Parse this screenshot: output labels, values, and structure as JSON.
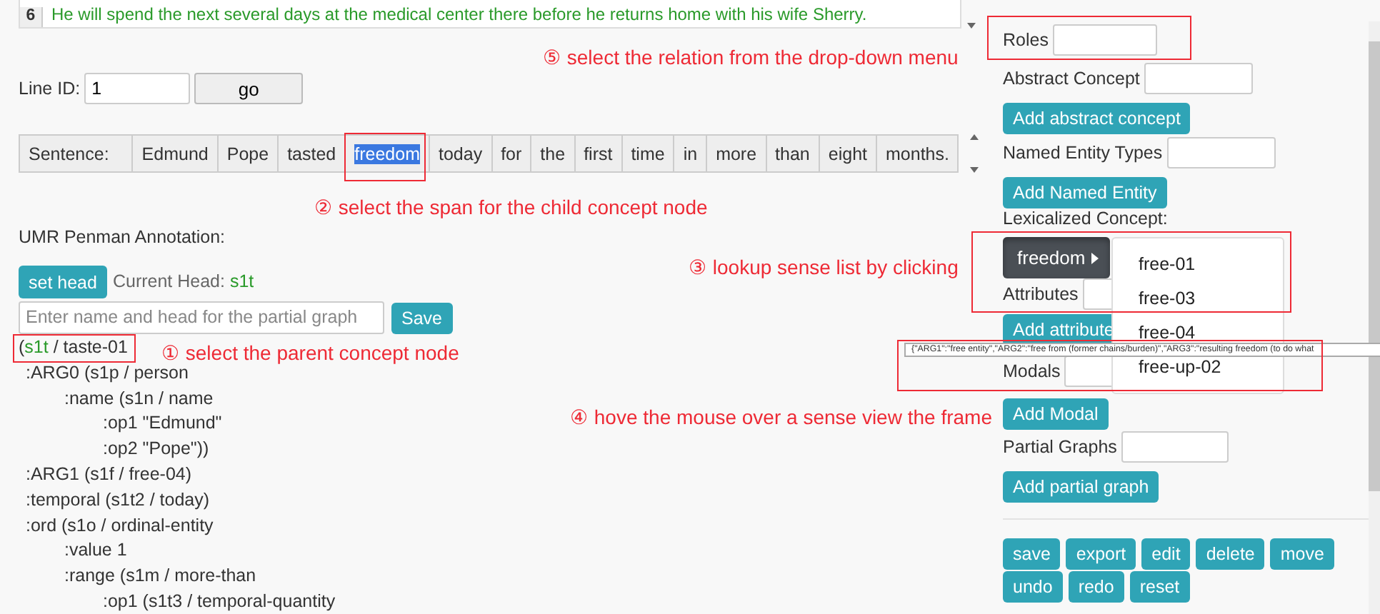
{
  "sentence_list": {
    "number": "6",
    "text": "He will spend the next several days at the medical center there before he returns home with his wife Sherry."
  },
  "line_id": {
    "label": "Line ID:",
    "value": "1",
    "button": "go"
  },
  "sentence": {
    "label": "Sentence:",
    "tokens": [
      {
        "text": "Edmund",
        "selected": false
      },
      {
        "text": "Pope",
        "selected": false
      },
      {
        "text": "tasted",
        "selected": false
      },
      {
        "text": "freedom",
        "selected": true
      },
      {
        "text": "today",
        "selected": false
      },
      {
        "text": "for",
        "selected": false
      },
      {
        "text": "the",
        "selected": false
      },
      {
        "text": "first",
        "selected": false
      },
      {
        "text": "time",
        "selected": false
      },
      {
        "text": "in",
        "selected": false
      },
      {
        "text": "more",
        "selected": false
      },
      {
        "text": "than",
        "selected": false
      },
      {
        "text": "eight",
        "selected": false
      },
      {
        "text": "months.",
        "selected": false
      }
    ]
  },
  "annotation": {
    "title": "UMR Penman Annotation:",
    "set_head_button": "set head",
    "current_head_label": "Current Head:",
    "current_head": "s1t",
    "partial_placeholder": "Enter name and head for the partial graph",
    "save_button": "Save",
    "graph": {
      "open": "(",
      "variable": "s1t",
      "rest": " / taste-01",
      "children": [
        {
          "text": ":ARG0 (s1p / person",
          "children": [
            {
              "text": ":name (s1n / name",
              "children": [
                {
                  "text": ":op1 \"Edmund\""
                },
                {
                  "text": ":op2 \"Pope\"))"
                }
              ]
            }
          ]
        },
        {
          "text": ":ARG1 (s1f / free-04)"
        },
        {
          "text": ":temporal (s1t2 / today)"
        },
        {
          "text": ":ord (s1o / ordinal-entity",
          "children": [
            {
              "text": ":value 1"
            },
            {
              "text": ":range (s1m / more-than",
              "children": [
                {
                  "text": ":op1 (s1t3 / temporal-quantity"
                }
              ]
            }
          ]
        }
      ]
    }
  },
  "panel": {
    "roles_label": "Roles",
    "abstract_label": "Abstract Concept",
    "abstract_button": "Add abstract concept",
    "ne_label": "Named Entity Types",
    "ne_button": "Add Named Entity",
    "lexicalized": {
      "label": "Lexicalized Concept:",
      "button": "freedom",
      "expanded": true,
      "senses": [
        "free-01",
        "free-03",
        "free-04",
        "free-up-02"
      ]
    },
    "attributes_label": "Attributes",
    "attributes_button": "Add attribute",
    "modals_label": "Modals",
    "modals_button": "Add Modal",
    "partial_label": "Partial Graphs",
    "partial_button": "Add partial graph",
    "actions": [
      [
        "save",
        "export",
        "edit",
        "delete",
        "move"
      ],
      [
        "undo",
        "redo",
        "reset"
      ]
    ]
  },
  "tooltip": "{\"ARG1\":\"free entity\",\"ARG2\":\"free from (former chains/burden)\",\"ARG3\":\"resulting freedom (to do what",
  "callouts": [
    {
      "mark": "⑤",
      "text": "select the relation from the drop-down menu"
    },
    {
      "mark": "②",
      "text": "select the span for the child concept node"
    },
    {
      "mark": "③",
      "text": "lookup sense list by clicking"
    },
    {
      "mark": "①",
      "text": "select the parent concept node"
    },
    {
      "mark": "④",
      "text": "hove the mouse over a sense view the frame"
    }
  ]
}
